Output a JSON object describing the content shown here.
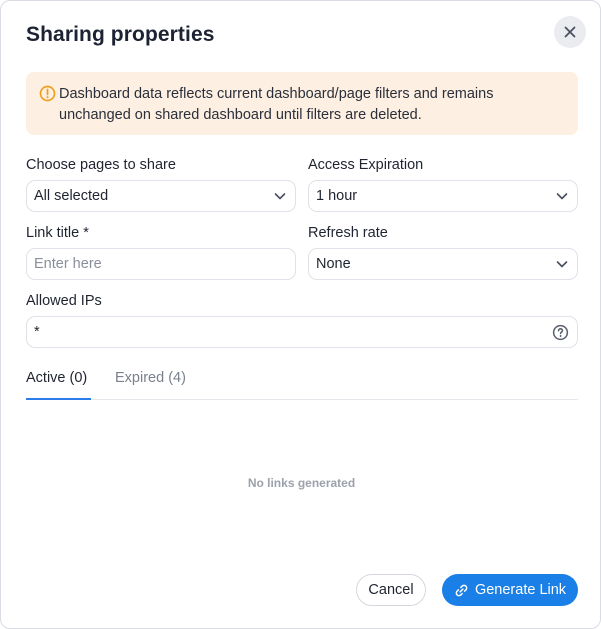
{
  "dialog": {
    "title": "Sharing properties"
  },
  "alert": {
    "text": "Dashboard data reflects current dashboard/page filters and remains unchanged on shared dashboard until filters are deleted."
  },
  "form": {
    "pages": {
      "label": "Choose pages to share",
      "value": "All selected"
    },
    "expiration": {
      "label": "Access Expiration",
      "value": "1 hour"
    },
    "link_title": {
      "label": "Link title *",
      "placeholder": "Enter here"
    },
    "refresh": {
      "label": "Refresh rate",
      "value": "None"
    },
    "allowed_ips": {
      "label": "Allowed IPs",
      "value": "*"
    }
  },
  "tabs": [
    {
      "label": "Active (0)",
      "active": true
    },
    {
      "label": "Expired (4)",
      "active": false
    }
  ],
  "empty_state": "No links generated",
  "footer": {
    "cancel_label": "Cancel",
    "generate_label": "Generate Link"
  },
  "colors": {
    "accent": "#1a7fe6",
    "warning_bg": "#fdf0e2",
    "warning_icon": "#f0a020"
  },
  "icons": {
    "close": "close-icon",
    "warning": "warning-circle-icon",
    "chevron": "chevron-down-icon",
    "help": "question-circle-icon",
    "link": "link-icon"
  }
}
